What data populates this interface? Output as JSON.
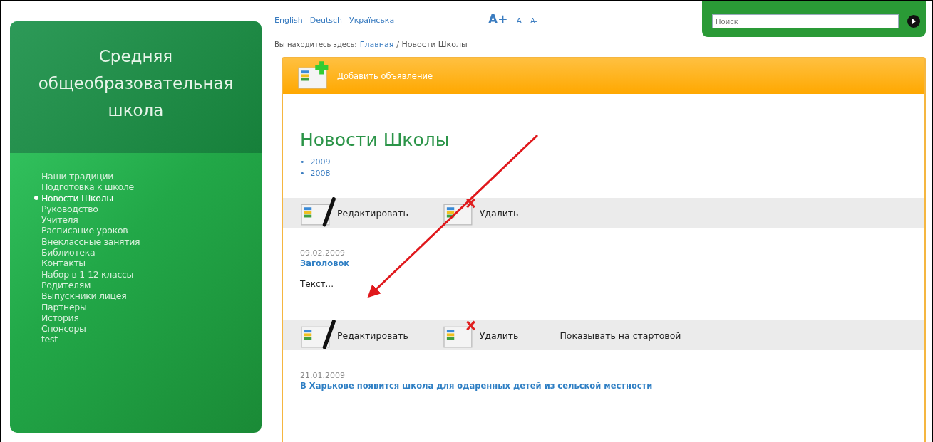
{
  "sidebar": {
    "title": "Средняя общеобразовательная школа",
    "items": [
      {
        "label": "Наши традиции",
        "selected": false
      },
      {
        "label": "Подготовка к школе",
        "selected": false
      },
      {
        "label": "Новости Школы",
        "selected": true
      },
      {
        "label": "Руководство",
        "selected": false
      },
      {
        "label": "Учителя",
        "selected": false
      },
      {
        "label": "Расписание уроков",
        "selected": false
      },
      {
        "label": "Внеклассные занятия",
        "selected": false
      },
      {
        "label": "Библиотека",
        "selected": false
      },
      {
        "label": "Контакты",
        "selected": false
      },
      {
        "label": "Набор в 1-12 классы",
        "selected": false
      },
      {
        "label": "Родителям",
        "selected": false
      },
      {
        "label": "Выпускники лицея",
        "selected": false
      },
      {
        "label": "Партнеры",
        "selected": false
      },
      {
        "label": "История",
        "selected": false
      },
      {
        "label": "Спонсоры",
        "selected": false
      },
      {
        "label": "test",
        "selected": false
      }
    ]
  },
  "languages": [
    "English",
    "Deutsch",
    "Українська"
  ],
  "font_sizes": [
    "A+",
    "A",
    "A-"
  ],
  "search": {
    "placeholder": "Поиск"
  },
  "breadcrumb": {
    "label": "Вы находитесь здесь:",
    "items": [
      {
        "kind": "link",
        "text": "Главная"
      },
      {
        "kind": "text",
        "text": "/ Новости Школы"
      }
    ]
  },
  "add_button": "Добавить объявление",
  "heading": "Новости Школы",
  "years": [
    {
      "bullet": "•",
      "label": "2009"
    },
    {
      "bullet": "•",
      "label": "2008"
    }
  ],
  "posts": [
    {
      "actions": [
        {
          "kind": "edit",
          "label": "Редактировать"
        },
        {
          "kind": "delete",
          "label": "Удалить"
        }
      ],
      "date": "09.02.2009",
      "title": "Заголовок",
      "text": "Текст..."
    },
    {
      "actions": [
        {
          "kind": "edit",
          "label": "Редактировать"
        },
        {
          "kind": "delete",
          "label": "Удалить"
        },
        {
          "kind": "plain",
          "label": "Показывать на стартовой"
        }
      ],
      "date": "21.01.2009",
      "title": "В Харькове появится школа для одаренных детей из сельской местности"
    }
  ]
}
